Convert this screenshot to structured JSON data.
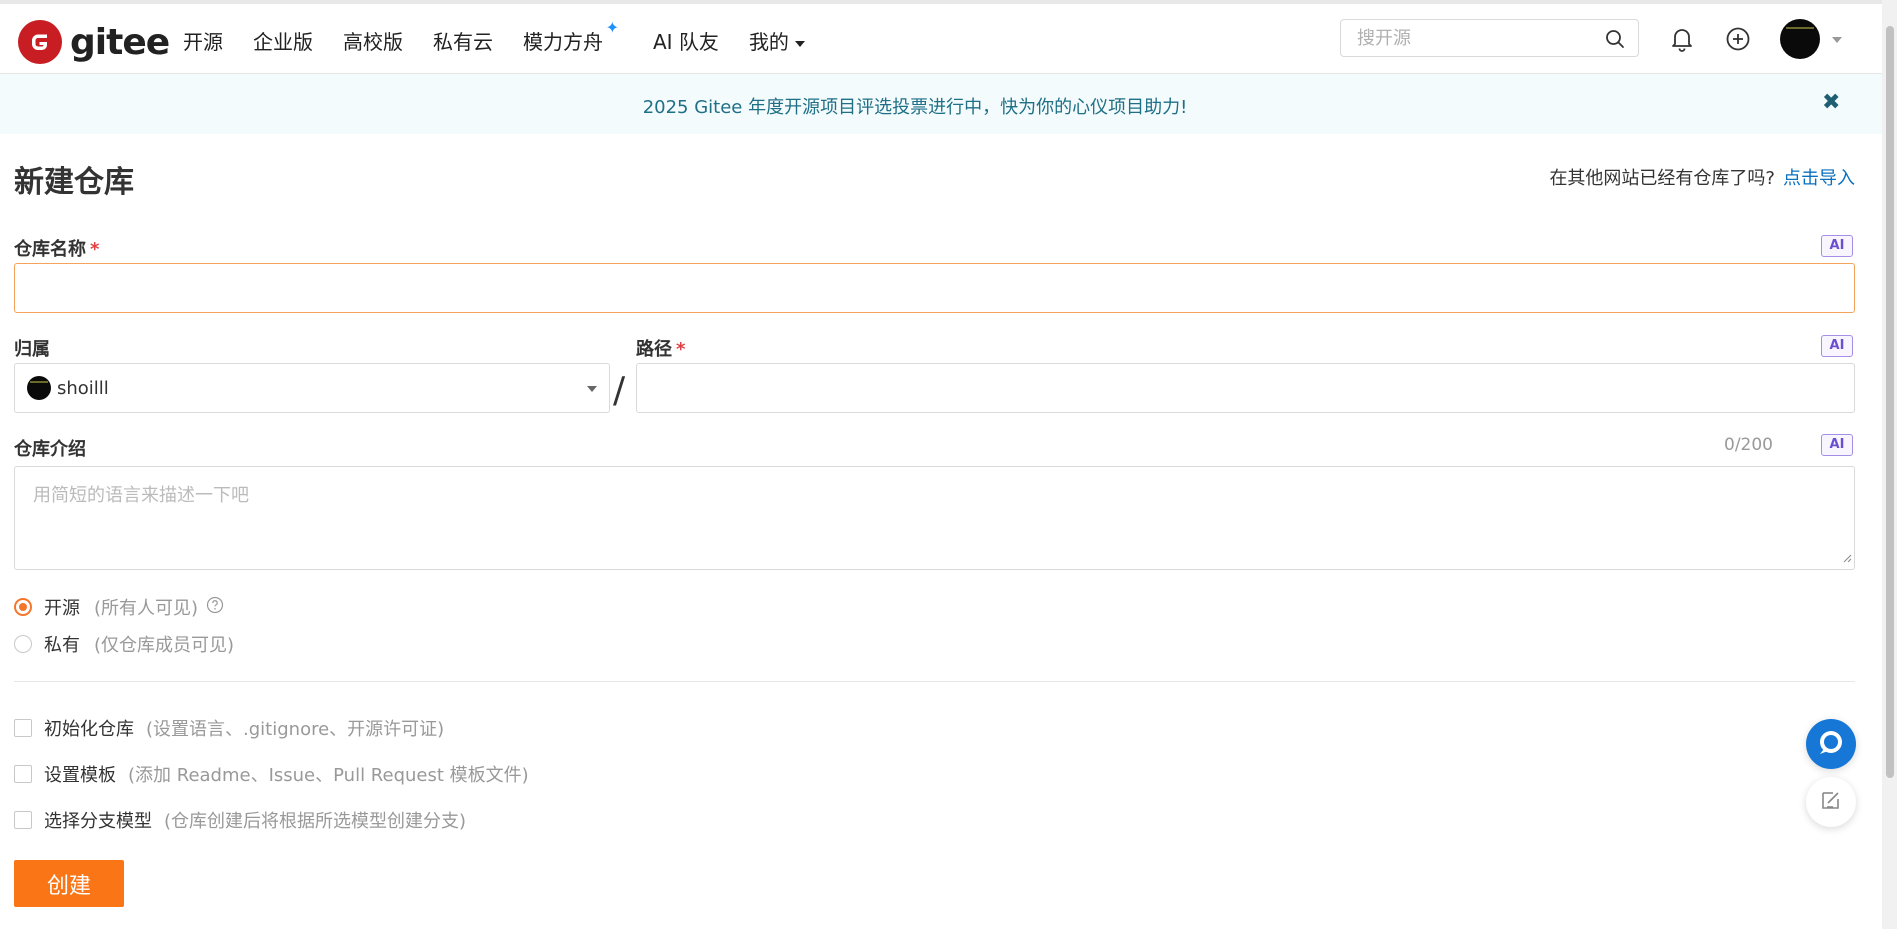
{
  "header": {
    "logo_text": "gitee",
    "nav": [
      {
        "label": "开源"
      },
      {
        "label": "企业版"
      },
      {
        "label": "高校版"
      },
      {
        "label": "私有云"
      },
      {
        "label": "模力方舟"
      },
      {
        "label": "AI 队友"
      },
      {
        "label": "我的"
      }
    ],
    "spark_glyph": "✦",
    "search_placeholder": "搜开源"
  },
  "banner": {
    "text": "2025 Gitee 年度开源项目评选投票进行中，快为你的心仪项目助力!",
    "close_glyph": "✖"
  },
  "page": {
    "title": "新建仓库",
    "import_prompt": "在其他网站已经有仓库了吗?",
    "import_link": "点击导入"
  },
  "form": {
    "repo_name_label": "仓库名称",
    "required_mark": "*",
    "ai_badge": "AI",
    "repo_name_value": "",
    "owner_label": "归属",
    "owner_value": "shoilll",
    "path_separator": "/",
    "path_label": "路径",
    "path_value": "",
    "desc_label": "仓库介绍",
    "desc_counter": "0/200",
    "desc_placeholder": "用简短的语言来描述一下吧",
    "visibility": [
      {
        "label": "开源",
        "hint": "(所有人可见)",
        "selected": true
      },
      {
        "label": "私有",
        "hint": "(仅仓库成员可见)",
        "selected": false
      }
    ],
    "options": [
      {
        "label": "初始化仓库",
        "hint": "(设置语言、.gitignore、开源许可证)"
      },
      {
        "label": "设置模板",
        "hint": "(添加 Readme、Issue、Pull Request 模板文件)"
      },
      {
        "label": "选择分支模型",
        "hint": "(仓库创建后将根据所选模型创建分支)"
      }
    ],
    "submit_label": "创建"
  },
  "colors": {
    "brand_red": "#c71d23",
    "accent_orange": "#fa7516",
    "link_blue": "#0b6fbf",
    "banner_bg": "#f3fbfd",
    "banner_text": "#1f6f86"
  },
  "icons": {
    "search": "search-icon",
    "bell": "bell-icon",
    "plus": "plus-circle-icon",
    "help": "question-circle-icon",
    "chat": "chat-icon",
    "feedback": "feedback-icon"
  }
}
